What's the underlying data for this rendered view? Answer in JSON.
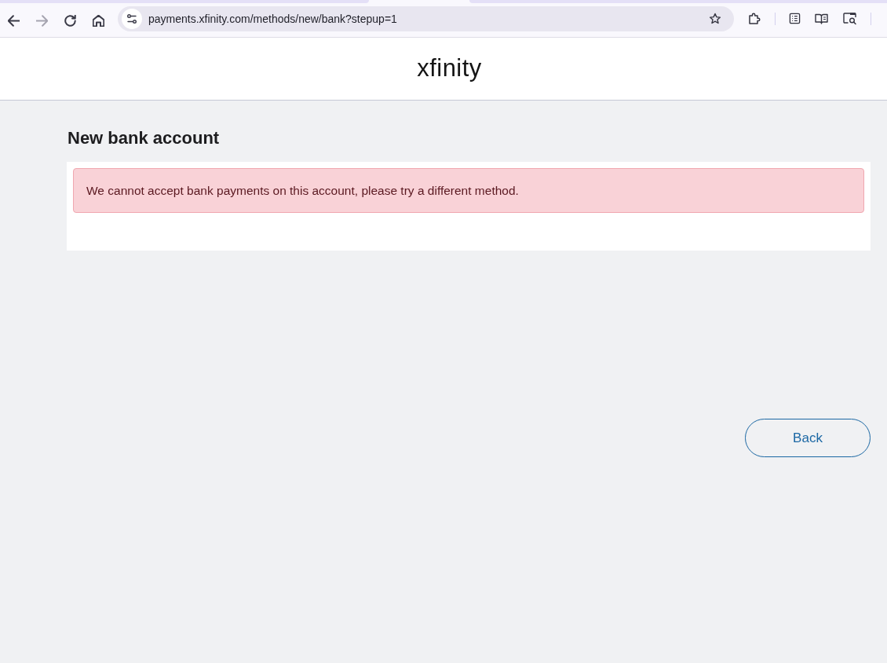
{
  "toolbar": {
    "nav_buttons": [
      {
        "kind": "back",
        "disabled": false
      },
      {
        "kind": "forward",
        "disabled": true
      },
      {
        "kind": "reload",
        "disabled": false
      },
      {
        "kind": "home",
        "disabled": false
      }
    ],
    "address_bar": {
      "url": "payments.xfinity.com/methods/new/bank?stepup=1"
    }
  },
  "header": {
    "logo": "xfinity"
  },
  "page": {
    "title": "New bank account",
    "alert": {
      "kind": "error",
      "message": "We cannot accept bank payments on this account, please try a different method."
    },
    "buttons": [
      {
        "label": "Back"
      }
    ]
  }
}
